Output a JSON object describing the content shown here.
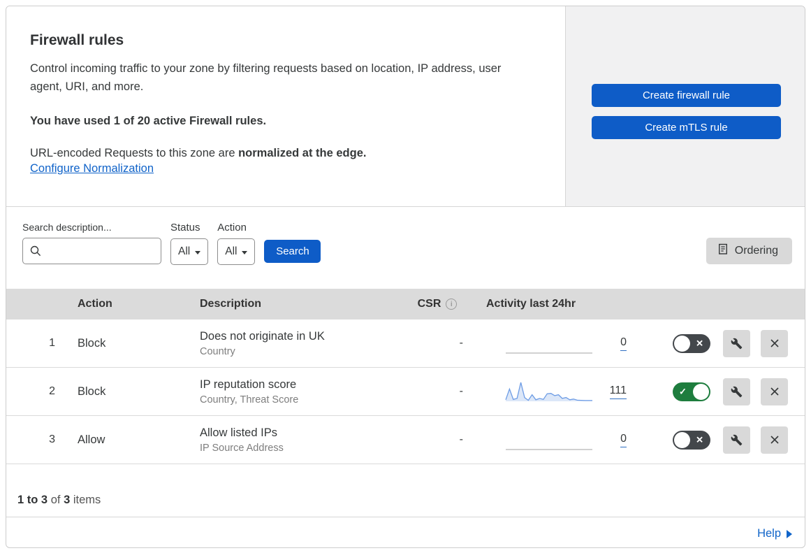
{
  "header": {
    "title": "Firewall rules",
    "description": "Control incoming traffic to your zone by filtering requests based on location, IP address, user agent, URI, and more.",
    "usage": "You have used 1 of 20 active Firewall rules.",
    "normalization_prefix": "URL-encoded Requests to this zone are ",
    "normalization_bold": "normalized at the edge.",
    "normalization_link": "Configure Normalization",
    "create_firewall_button": "Create firewall rule",
    "create_mtls_button": "Create mTLS rule"
  },
  "filters": {
    "search_label": "Search description...",
    "status_label": "Status",
    "status_value": "All",
    "action_label": "Action",
    "action_value": "All",
    "search_button": "Search",
    "ordering_button": "Ordering"
  },
  "table": {
    "columns": {
      "action": "Action",
      "description": "Description",
      "csr": "CSR",
      "activity": "Activity last 24hr"
    },
    "rows": [
      {
        "num": "1",
        "action": "Block",
        "description": "Does not originate in UK",
        "criteria": "Country",
        "csr": "-",
        "activity_count": "0",
        "enabled": false
      },
      {
        "num": "2",
        "action": "Block",
        "description": "IP reputation score",
        "criteria": "Country, Threat Score",
        "csr": "-",
        "activity_count": "111",
        "enabled": true
      },
      {
        "num": "3",
        "action": "Allow",
        "description": "Allow listed IPs",
        "criteria": "IP Source Address",
        "csr": "-",
        "activity_count": "0",
        "enabled": false
      }
    ]
  },
  "chart_data": {
    "type": "area",
    "title": "Activity last 24hr sparklines",
    "x": "hourly buckets over last 24 hours (unlabeled)",
    "ylim": [
      0,
      100
    ],
    "legend": "none",
    "series": [
      {
        "name": "Does not originate in UK",
        "total": 0,
        "values": [
          0,
          0,
          0,
          0,
          0,
          0,
          0,
          0,
          0,
          0,
          0,
          0,
          0,
          0,
          0,
          0,
          0,
          0,
          0,
          0,
          0,
          0,
          0,
          0
        ]
      },
      {
        "name": "IP reputation score",
        "total": 111,
        "values": [
          8,
          65,
          10,
          15,
          100,
          20,
          5,
          35,
          8,
          15,
          10,
          40,
          42,
          30,
          35,
          15,
          20,
          8,
          12,
          6,
          5,
          4,
          4,
          4
        ]
      },
      {
        "name": "Allow listed IPs",
        "total": 0,
        "values": [
          0,
          0,
          0,
          0,
          0,
          0,
          0,
          0,
          0,
          0,
          0,
          0,
          0,
          0,
          0,
          0,
          0,
          0,
          0,
          0,
          0,
          0,
          0,
          0
        ]
      }
    ]
  },
  "footer": {
    "range": "1 to 3",
    "of_label": "of",
    "total": "3",
    "items_label": "items",
    "help_label": "Help"
  },
  "icons": {
    "check": "✓",
    "cross": "✕",
    "info": "i"
  },
  "colors": {
    "accent_blue": "#0e5cc7",
    "link_blue": "#1064c9",
    "toggle_on_green": "#1e7d3e",
    "toggle_off_gray": "#43474b",
    "header_gray": "#dbdbdb",
    "panel_gray": "#f1f1f2",
    "sparkline_stroke": "#6d9ce5",
    "sparkline_fill": "#dce7f8"
  }
}
